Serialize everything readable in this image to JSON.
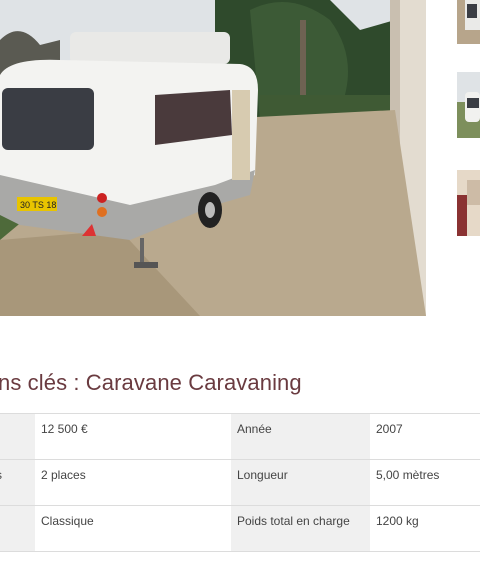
{
  "gallery": {
    "main_photo": "caravan-photo",
    "thumbnails": [
      "caravan-rear-thumb",
      "caravan-side-thumb",
      "caravan-interior-thumb"
    ]
  },
  "section_title": "ns clés : Caravane Caravaning",
  "specs": {
    "rows": [
      {
        "label1": "",
        "value1": "12 500 €",
        "label2": "Année",
        "value2": "2007"
      },
      {
        "label1": "s",
        "value1": "2 places",
        "label2": "Longueur",
        "value2": "5,00 mètres"
      },
      {
        "label1": "",
        "value1": "Classique",
        "label2": "Poids total en charge",
        "value2": "1200 kg"
      }
    ]
  },
  "photo_plate": "30 TS 18",
  "colors": {
    "title": "#6a3b40",
    "label_bg": "#f0f0f0",
    "border": "#dcdcdc"
  }
}
